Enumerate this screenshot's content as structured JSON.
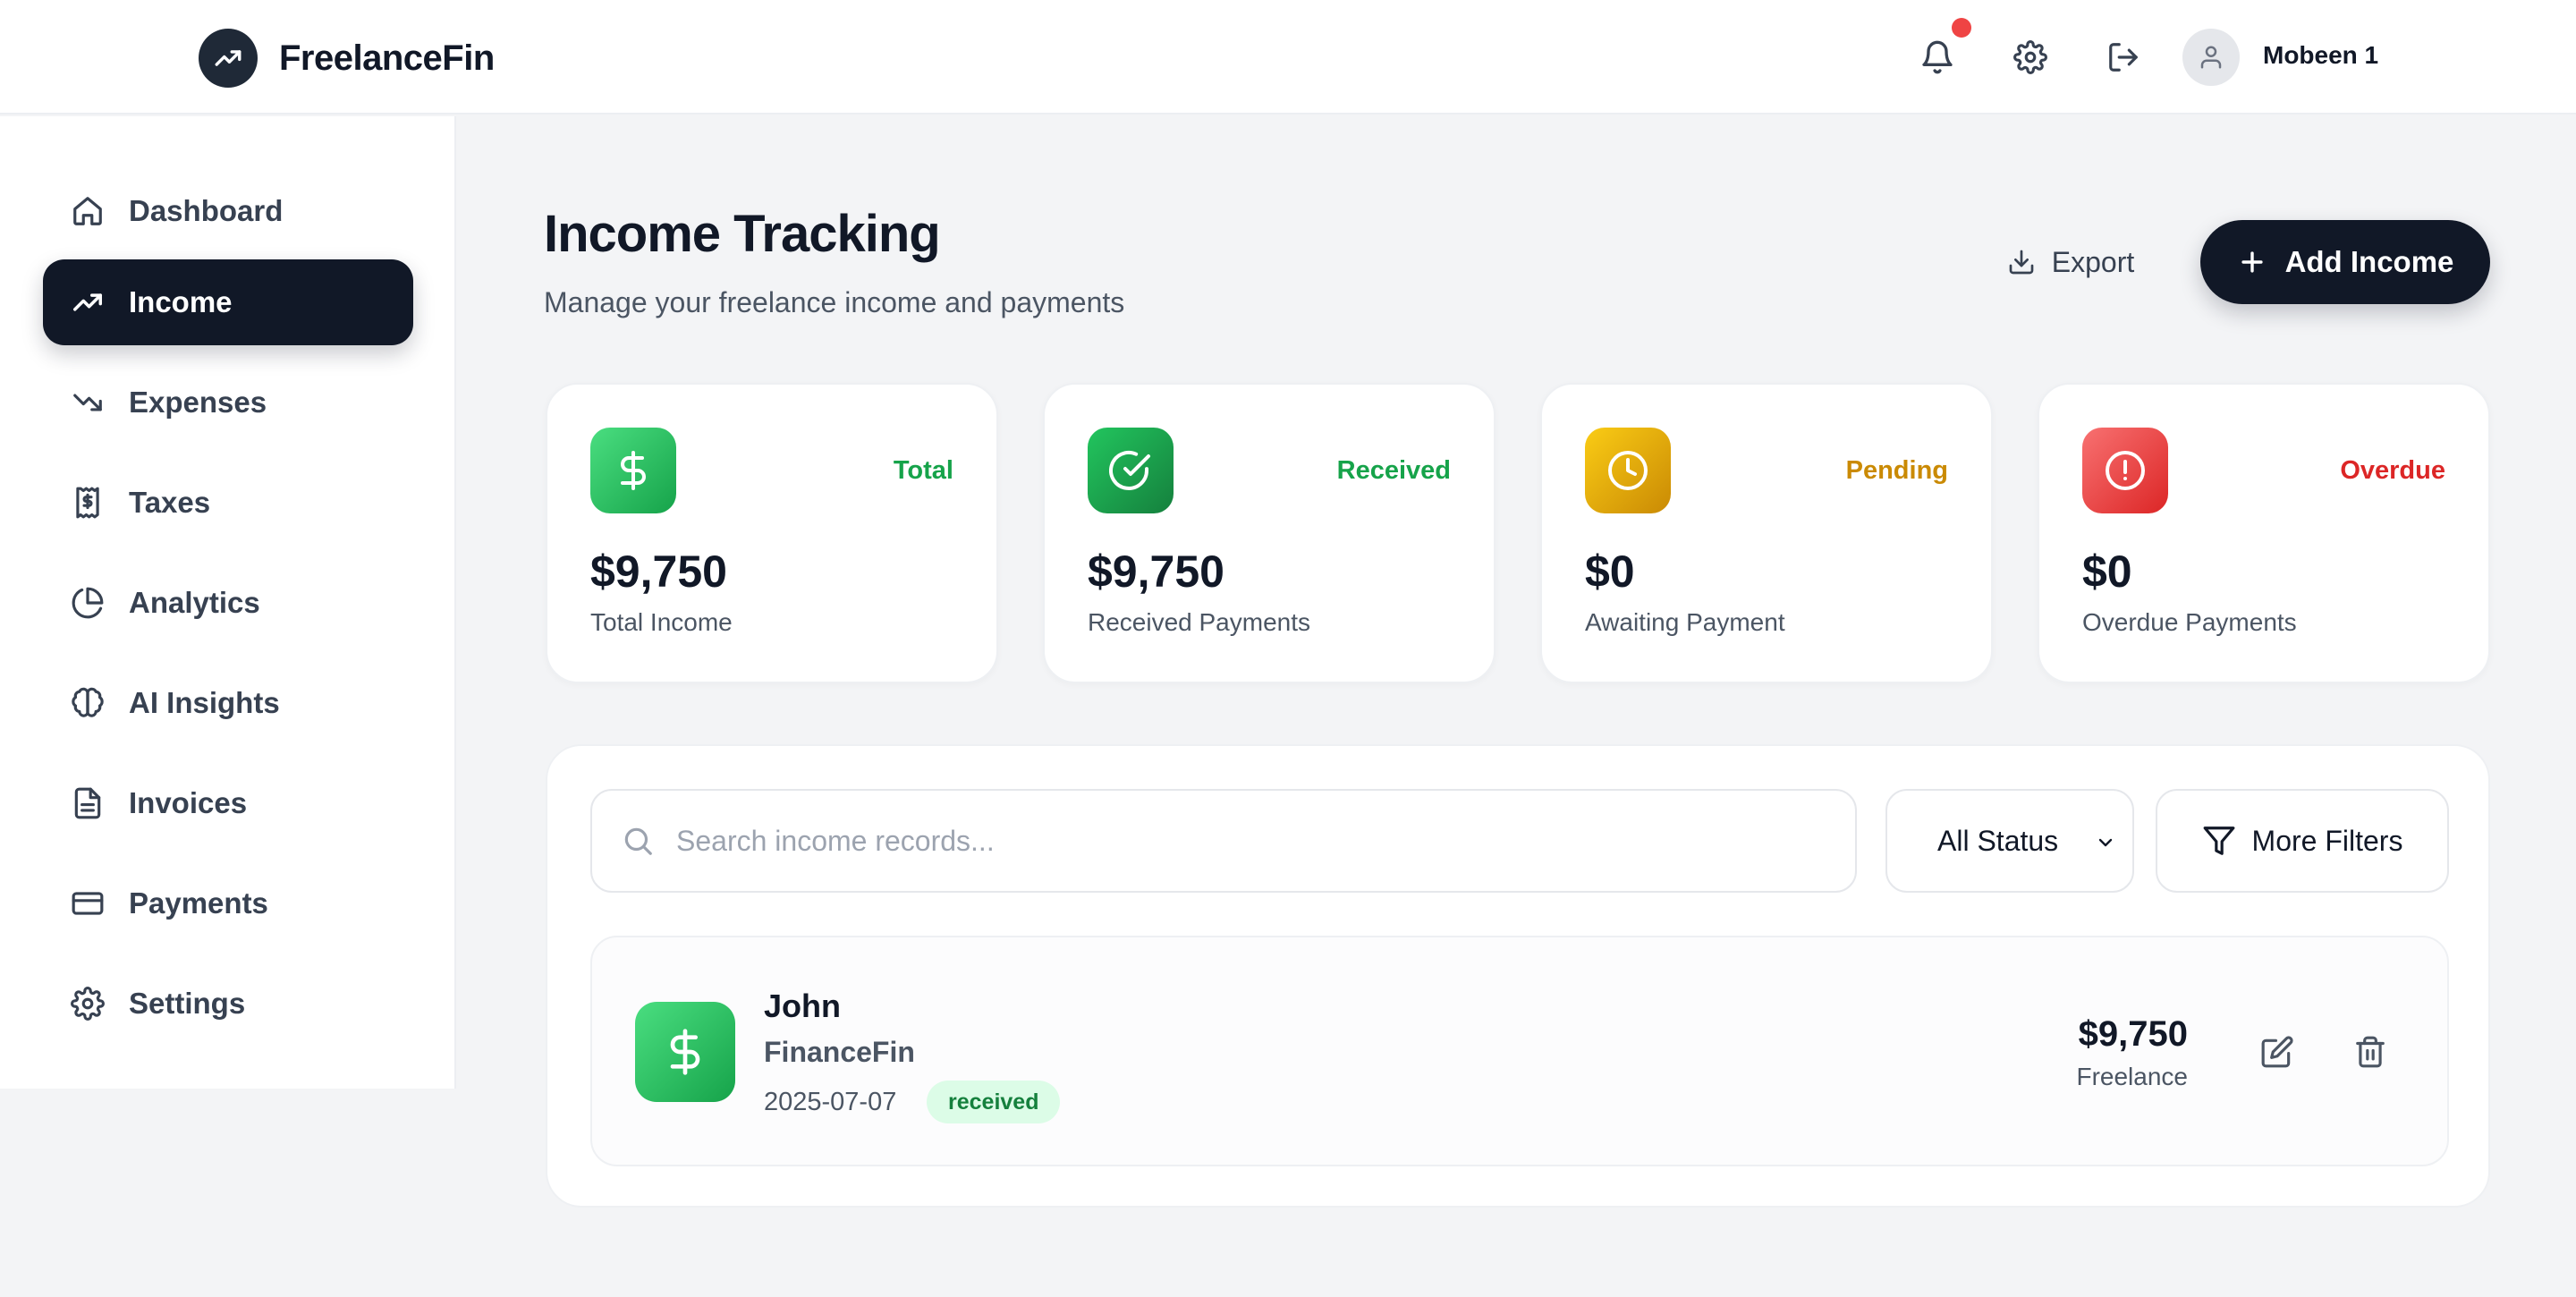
{
  "app": {
    "name": "FreelanceFin"
  },
  "header": {
    "user_name": "Mobeen 1",
    "icons": [
      "bell-icon",
      "gear-icon",
      "logout-icon",
      "user-icon"
    ]
  },
  "sidebar": {
    "items": [
      {
        "label": "Dashboard",
        "icon": "home-icon",
        "active": false
      },
      {
        "label": "Income",
        "icon": "trending-up-icon",
        "active": true
      },
      {
        "label": "Expenses",
        "icon": "trending-down-icon",
        "active": false
      },
      {
        "label": "Taxes",
        "icon": "receipt-icon",
        "active": false
      },
      {
        "label": "Analytics",
        "icon": "pie-chart-icon",
        "active": false
      },
      {
        "label": "AI Insights",
        "icon": "brain-icon",
        "active": false
      },
      {
        "label": "Invoices",
        "icon": "file-text-icon",
        "active": false
      },
      {
        "label": "Payments",
        "icon": "credit-card-icon",
        "active": false
      },
      {
        "label": "Settings",
        "icon": "gear-icon",
        "active": false
      }
    ]
  },
  "page": {
    "title": "Income Tracking",
    "subtitle": "Manage your freelance income and payments",
    "export_label": "Export",
    "add_label": "Add Income"
  },
  "stats": [
    {
      "tag": "Total",
      "value": "$9,750",
      "label": "Total Income",
      "color": "#16a34a",
      "icon": "dollar-icon"
    },
    {
      "tag": "Received",
      "value": "$9,750",
      "label": "Received Payments",
      "color": "#16a34a",
      "icon": "check-circle-icon"
    },
    {
      "tag": "Pending",
      "value": "$0",
      "label": "Awaiting Payment",
      "color": "#ca8a04",
      "icon": "clock-icon"
    },
    {
      "tag": "Overdue",
      "value": "$0",
      "label": "Overdue Payments",
      "color": "#dc2626",
      "icon": "alert-circle-icon"
    }
  ],
  "filters": {
    "search_placeholder": "Search income records...",
    "search_value": "",
    "status_selected": "All Status",
    "more_filters_label": "More Filters"
  },
  "records": [
    {
      "name": "John",
      "company": "FinanceFin",
      "date": "2025-07-07",
      "status": "received",
      "amount": "$9,750",
      "category": "Freelance"
    }
  ],
  "colors": {
    "accent": "#111827",
    "success": "#16a34a",
    "warning": "#ca8a04",
    "danger": "#dc2626",
    "notification": "#ef4444"
  }
}
